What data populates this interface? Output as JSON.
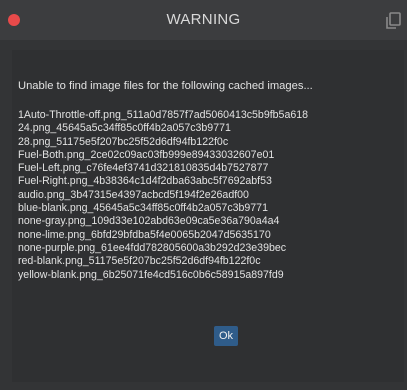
{
  "window": {
    "title": "WARNING",
    "accent_close": "#e84a4a",
    "icons": {
      "close": "close-dot-icon",
      "copy": "copy-icon"
    }
  },
  "dialog": {
    "message": "Unable to find image files for the following cached images...",
    "files": [
      "1Auto-Throttle-off.png_511a0d7857f7ad5060413c5b9fb5a618",
      "24.png_45645a5c34ff85c0ff4b2a057c3b9771",
      "28.png_51175e5f207bc25f52d6df94fb122f0c",
      "Fuel-Both.png_2ce02c09ac03fb999e89433032607e01",
      "Fuel-Left.png_c76fe4ef3741d321810835d4b7527877",
      "Fuel-Right.png_4b38364c1d4f2dba63abc5f7692abf53",
      "audio.png_3b47315e4397acbcd5f194f2e26adf00",
      "blue-blank.png_45645a5c34ff85c0ff4b2a057c3b9771",
      "none-gray.png_109d33e102abd63e09ca5e36a790a4a4",
      "none-lime.png_6bfd29bfdba5f4e0065b2047d5635170",
      "none-purple.png_61ee4fdd782805600a3b292d23e39bec",
      "red-blank.png_51175e5f207bc25f52d6df94fb122f0c",
      "yellow-blank.png_6b25071fe4cd516c0b6c58915a897fd9"
    ],
    "ok_label": "Ok",
    "ok_color": "#2f5c8a"
  }
}
